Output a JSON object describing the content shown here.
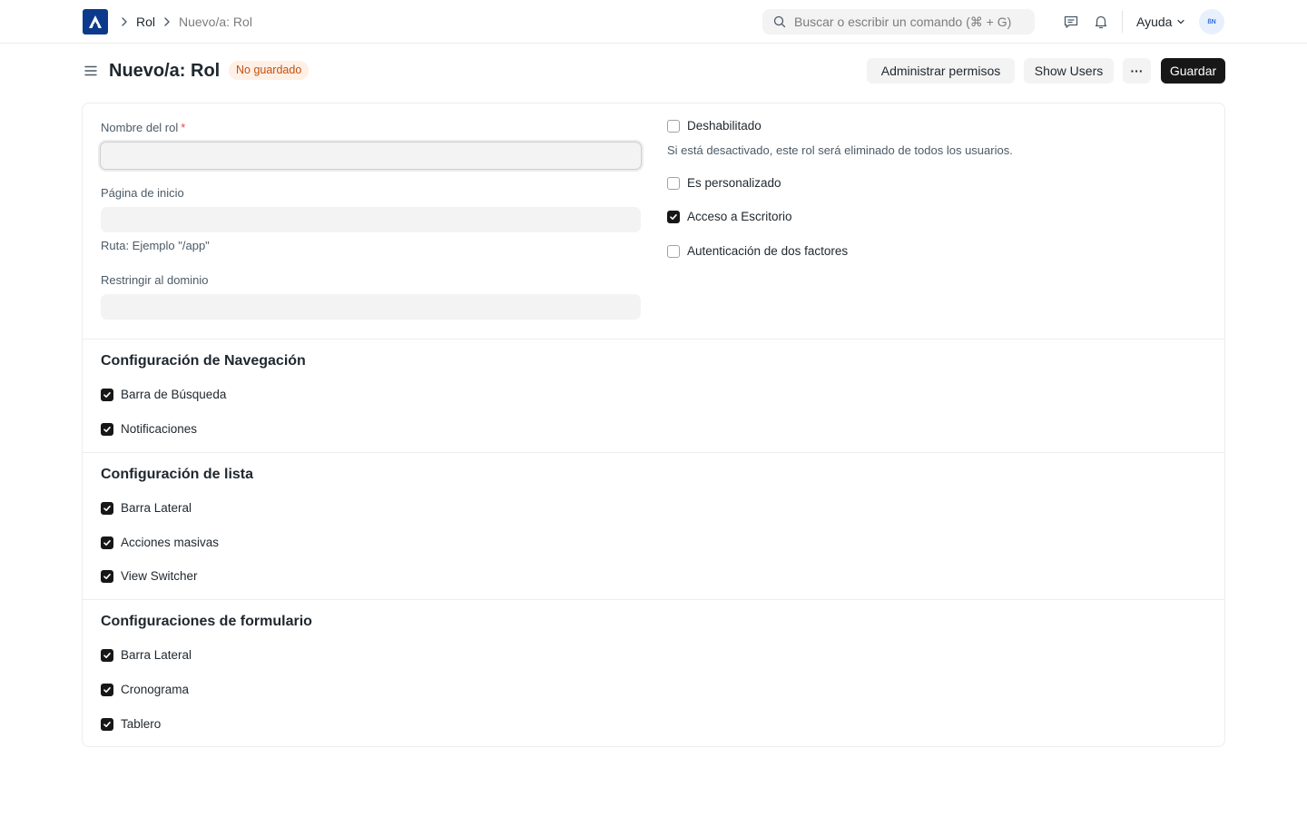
{
  "navbar": {
    "breadcrumbs": [
      "Rol",
      "Nuevo/a: Rol"
    ],
    "search_placeholder": "Buscar o escribir un comando (⌘ + G)",
    "help_label": "Ayuda",
    "avatar_initials": "ßN"
  },
  "page": {
    "title": "Nuevo/a: Rol",
    "status_badge": "No guardado",
    "buttons": {
      "manage_permissions": "Administrar permisos",
      "show_users": "Show Users",
      "more": "···",
      "save": "Guardar"
    }
  },
  "form": {
    "role_name": {
      "label": "Nombre del rol",
      "required_mark": "*",
      "value": ""
    },
    "home_page": {
      "label": "Página de inicio",
      "value": "",
      "description": "Ruta: Ejemplo \"/app\""
    },
    "restrict_domain": {
      "label": "Restringir al dominio",
      "value": ""
    },
    "right_checks": [
      {
        "label": "Deshabilitado",
        "checked": false
      },
      {
        "label": "Es personalizado",
        "checked": false
      },
      {
        "label": "Acceso a Escritorio",
        "checked": true
      },
      {
        "label": "Autenticación de dos factores",
        "checked": false
      }
    ],
    "disabled_description": "Si está desactivado, este rol será eliminado de todos los usuarios.",
    "sections": [
      {
        "title": "Configuración de Navegación",
        "items": [
          {
            "label": "Barra de Búsqueda",
            "checked": true
          },
          {
            "label": "Notificaciones",
            "checked": true
          }
        ]
      },
      {
        "title": "Configuración de lista",
        "items": [
          {
            "label": "Barra Lateral",
            "checked": true
          },
          {
            "label": "Acciones masivas",
            "checked": true
          },
          {
            "label": "View Switcher",
            "checked": true
          }
        ]
      },
      {
        "title": "Configuraciones de formulario",
        "items": [
          {
            "label": "Barra Lateral",
            "checked": true
          },
          {
            "label": "Cronograma",
            "checked": true
          },
          {
            "label": "Tablero",
            "checked": true
          }
        ]
      }
    ]
  },
  "colors": {
    "primary_button": "#171717",
    "badge_bg": "#fff0e6",
    "badge_text": "#c4500d",
    "logo_bg": "#0b3a8c"
  }
}
